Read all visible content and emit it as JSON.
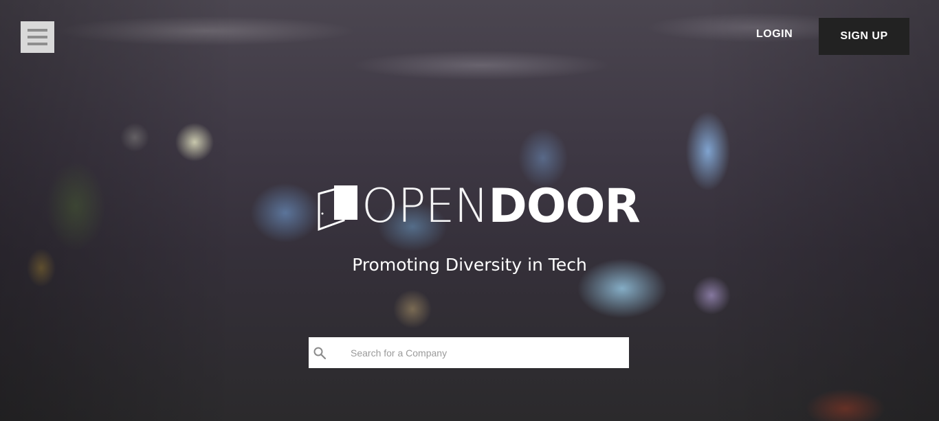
{
  "nav": {
    "menu_icon": "hamburger-menu-icon",
    "login_label": "LOGIN",
    "signup_label": "SIGN UP"
  },
  "hero": {
    "logo": {
      "icon": "open-door-icon",
      "text_light": "OPEN",
      "text_bold": "DOOR"
    },
    "tagline": "Promoting Diversity in Tech"
  },
  "search": {
    "icon": "search-icon",
    "placeholder": "Search for a Company",
    "value": ""
  },
  "colors": {
    "signup_bg": "#222222",
    "menu_bg": "#d9d9d9",
    "menu_bars": "#8e8e8e",
    "text": "#ffffff"
  }
}
